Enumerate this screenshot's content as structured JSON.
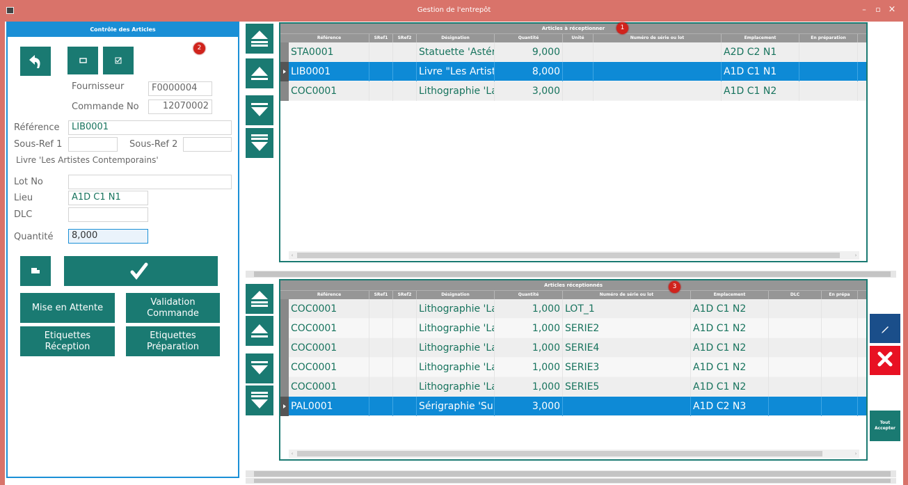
{
  "window": {
    "title": "Gestion de l'entrepôt",
    "minimize": "–",
    "maximize": "▫",
    "close": "×"
  },
  "badges": {
    "one": "1",
    "two": "2",
    "three": "3"
  },
  "left_panel": {
    "header": "Contrôle des Articles",
    "fournisseur_label": "Fournisseur",
    "fournisseur_value": "F0000004",
    "commande_label": "Commande No",
    "commande_value": "12070002",
    "reference_label": "Référence",
    "reference_value": "LIB0001",
    "sousref1_label": "Sous-Ref 1",
    "sousref1_value": "",
    "sousref2_label": "Sous-Ref 2",
    "sousref2_value": "",
    "description": "Livre 'Les Artistes Contemporains'",
    "lot_label": "Lot No",
    "lot_value": "",
    "lieu_label": "Lieu",
    "lieu_value": "A1D C1 N1",
    "dlc_label": "DLC",
    "dlc_value": "",
    "quantite_label": "Quantité",
    "quantite_value": "8,000",
    "mise_en_attente": "Mise en Attente",
    "validation_commande_1": "Validation",
    "validation_commande_2": "Commande",
    "etiquettes_reception_1": "Etiquettes",
    "etiquettes_reception_2": "Réception",
    "etiquettes_preparation_1": "Etiquettes",
    "etiquettes_preparation_2": "Préparation"
  },
  "icons": {
    "back": "undo-arrow-icon",
    "window": "window-icon",
    "check_doc": "checklist-icon",
    "scanner": "scanner-icon",
    "confirm": "checkmark-icon",
    "first": "first-record-icon",
    "prev": "previous-record-icon",
    "next": "next-record-icon",
    "last": "last-record-icon",
    "edit": "pencil-icon",
    "delete": "delete-x-icon"
  },
  "grid_top": {
    "title": "Articles à réceptionner",
    "columns": [
      "Référence",
      "SRef1",
      "SRef2",
      "Désignation",
      "Quantité",
      "Unité",
      "Numéro de série ou lot",
      "Emplacement",
      "En préparation"
    ],
    "rows": [
      {
        "ref": "STA0001",
        "sref1": "",
        "sref2": "",
        "designation": "Statuette 'Astérix",
        "quantite": "9,000",
        "unite": "",
        "serie": "",
        "emplacement": "A2D C2 N1",
        "prep": ""
      },
      {
        "ref": "LIB0001",
        "sref1": "",
        "sref2": "",
        "designation": "Livre \"Les Artiste",
        "quantite": "8,000",
        "unite": "",
        "serie": "",
        "emplacement": "A1D C1 N1",
        "prep": ""
      },
      {
        "ref": "COC0001",
        "sref1": "",
        "sref2": "",
        "designation": "Lithographie 'La",
        "quantite": "3,000",
        "unite": "",
        "serie": "",
        "emplacement": "A1D C1 N2",
        "prep": ""
      }
    ]
  },
  "grid_bottom": {
    "title": "Articles réceptionnés",
    "columns": [
      "Référence",
      "SRef1",
      "SRef2",
      "Désignation",
      "Quantité",
      "Numéro de série ou lot",
      "Emplacement",
      "DLC",
      "En prépa"
    ],
    "rows": [
      {
        "ref": "COC0001",
        "sref1": "",
        "sref2": "",
        "designation": "Lithographie 'La",
        "quantite": "1,000",
        "serie": "LOT_1",
        "emplacement": "A1D C1 N2",
        "dlc": "",
        "prep": ""
      },
      {
        "ref": "COC0001",
        "sref1": "",
        "sref2": "",
        "designation": "Lithographie 'La",
        "quantite": "1,000",
        "serie": "SERIE2",
        "emplacement": "A1D C1 N2",
        "dlc": "",
        "prep": ""
      },
      {
        "ref": "COC0001",
        "sref1": "",
        "sref2": "",
        "designation": "Lithographie 'La",
        "quantite": "1,000",
        "serie": "SERIE4",
        "emplacement": "A1D C1 N2",
        "dlc": "",
        "prep": ""
      },
      {
        "ref": "COC0001",
        "sref1": "",
        "sref2": "",
        "designation": "Lithographie 'La",
        "quantite": "1,000",
        "serie": "SERIE3",
        "emplacement": "A1D C1 N2",
        "dlc": "",
        "prep": ""
      },
      {
        "ref": "COC0001",
        "sref1": "",
        "sref2": "",
        "designation": "Lithographie 'La",
        "quantite": "1,000",
        "serie": "SERIE5",
        "emplacement": "A1D C1 N2",
        "dlc": "",
        "prep": ""
      },
      {
        "ref": "PAL0001",
        "sref1": "",
        "sref2": "",
        "designation": "Sérigraphie 'Sur",
        "quantite": "3,000",
        "serie": "",
        "emplacement": "A1D C2 N3",
        "dlc": "",
        "prep": ""
      }
    ]
  },
  "side_buttons": {
    "accept_1": "Tout",
    "accept_2": "Accepter"
  },
  "colors": {
    "teal": "#1a7a72",
    "blue": "#0e8ad6",
    "titlebar": "#d9736a",
    "delete": "#e81123",
    "edit": "#1a4e8a"
  }
}
